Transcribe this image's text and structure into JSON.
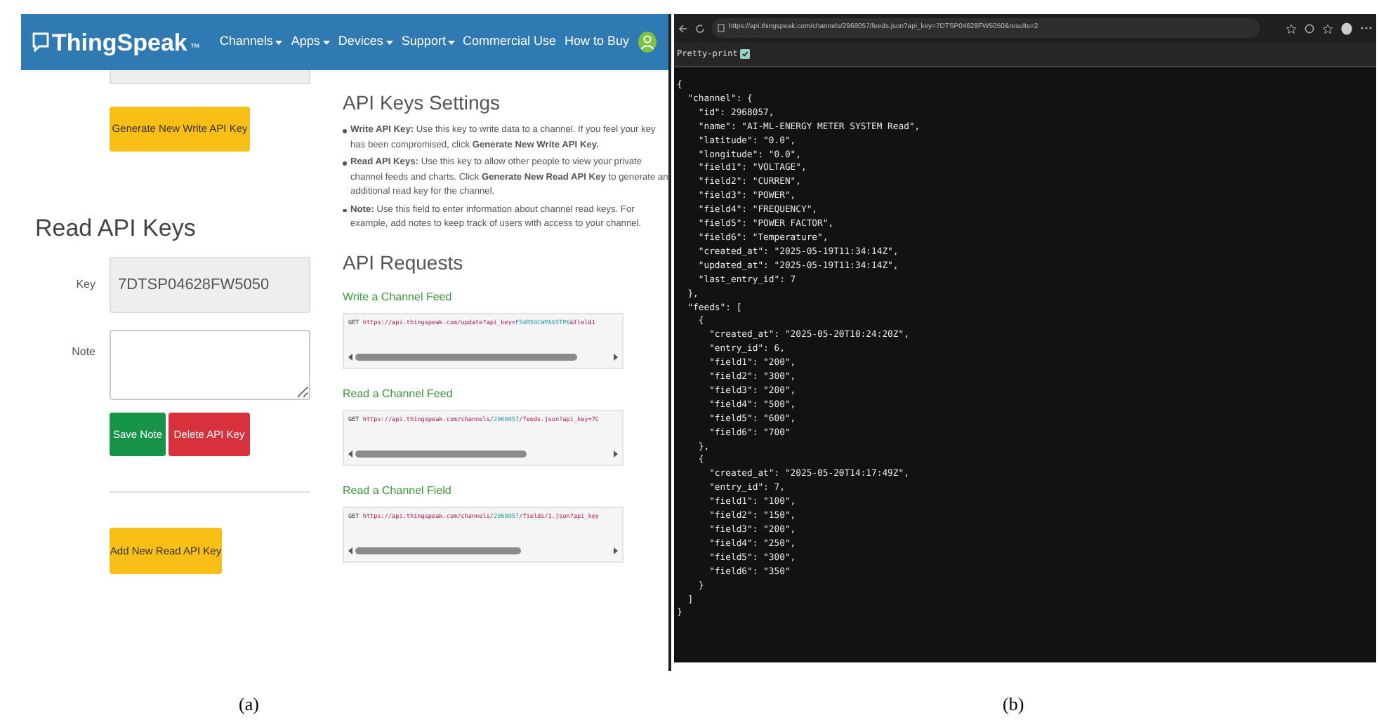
{
  "panel_a": {
    "header": {
      "brand": "ThingSpeak",
      "trademark": "™",
      "nav": [
        "Channels",
        "Apps",
        "Devices",
        "Support"
      ],
      "links": [
        "Commercial Use",
        "How to Buy"
      ]
    },
    "write_key_button": "Generate New Write API Key",
    "read_keys": {
      "title": "Read API Keys",
      "key_label": "Key",
      "key_value": "7DTSP04628FW5050",
      "note_label": "Note",
      "save_button": "Save Note",
      "delete_button": "Delete API Key",
      "add_button": "Add New Read API Key"
    },
    "settings": {
      "title": "API Keys Settings",
      "items": [
        "**Write API Key:** Use this key to write data to a channel. If you feel your key has been compromised, click **Generate New Write API Key.**",
        "**Read API Keys:** Use this key to allow other people to view your private channel feeds and charts. Click **Generate New Read API Key** to generate an additional read key for the channel.",
        "**Note:** Use this field to enter information about channel read keys. For example, add notes to keep track of users with access to your channel."
      ]
    },
    "requests": {
      "title": "API Requests",
      "items": [
        {
          "title": "Write a Channel Feed",
          "method": "GET",
          "parts": [
            {
              "kind": "url",
              "text": "https://api.thingspeak.com/update?api_key="
            },
            {
              "kind": "param",
              "text": "F54R5OCWPA65TP6"
            },
            {
              "kind": "url",
              "text": "&field1"
            }
          ]
        },
        {
          "title": "Read a Channel Feed",
          "method": "GET",
          "parts": [
            {
              "kind": "url",
              "text": "https://api.thingspeak.com/channels/"
            },
            {
              "kind": "param",
              "text": "2968057"
            },
            {
              "kind": "url",
              "text": "/feeds.json?api_key=7C"
            }
          ]
        },
        {
          "title": "Read a Channel Field",
          "method": "GET",
          "parts": [
            {
              "kind": "url",
              "text": "https://api.thingspeak.com/channels/"
            },
            {
              "kind": "param",
              "text": "2968057"
            },
            {
              "kind": "url",
              "text": "/fields/1.json?api_key"
            }
          ]
        }
      ]
    }
  },
  "panel_b": {
    "url": "https://api.thingspeak.com/channels/2968057/feeds.json?api_key=7DTSP04628FW5050&results=2",
    "pretty_print": {
      "label": "Pretty-print",
      "checked": true
    },
    "lines": [
      "{",
      "  \"channel\": {",
      "    \"id\": 2968057,",
      "    \"name\": \"AI-ML-ENERGY METER SYSTEM Read\",",
      "    \"latitude\": \"0.0\",",
      "    \"longitude\": \"0.0\",",
      "    \"field1\": \"VOLTAGE\",",
      "    \"field2\": \"CURREN\",",
      "    \"field3\": \"POWER\",",
      "    \"field4\": \"FREQUENCY\",",
      "    \"field5\": \"POWER FACTOR\",",
      "    \"field6\": \"Temperature\",",
      "    \"created_at\": \"2025-05-19T11:34:14Z\",",
      "    \"updated_at\": \"2025-05-19T11:34:14Z\",",
      "    \"last_entry_id\": 7",
      "  },",
      "  \"feeds\": [",
      "    {",
      "      \"created_at\": \"2025-05-20T10:24:20Z\",",
      "      \"entry_id\": 6,",
      "      \"field1\": \"200\",",
      "      \"field2\": \"300\",",
      "      \"field3\": \"200\",",
      "      \"field4\": \"500\",",
      "      \"field5\": \"600\",",
      "      \"field6\": \"700\"",
      "    },",
      "    {",
      "      \"created_at\": \"2025-05-20T14:17:49Z\",",
      "      \"entry_id\": 7,",
      "      \"field1\": \"100\",",
      "      \"field2\": \"150\",",
      "      \"field3\": \"200\",",
      "      \"field4\": \"250\",",
      "      \"field5\": \"300\",",
      "      \"field6\": \"350\"",
      "    }",
      "  ]",
      "}"
    ]
  },
  "captions": [
    "(a)",
    "(b)"
  ]
}
